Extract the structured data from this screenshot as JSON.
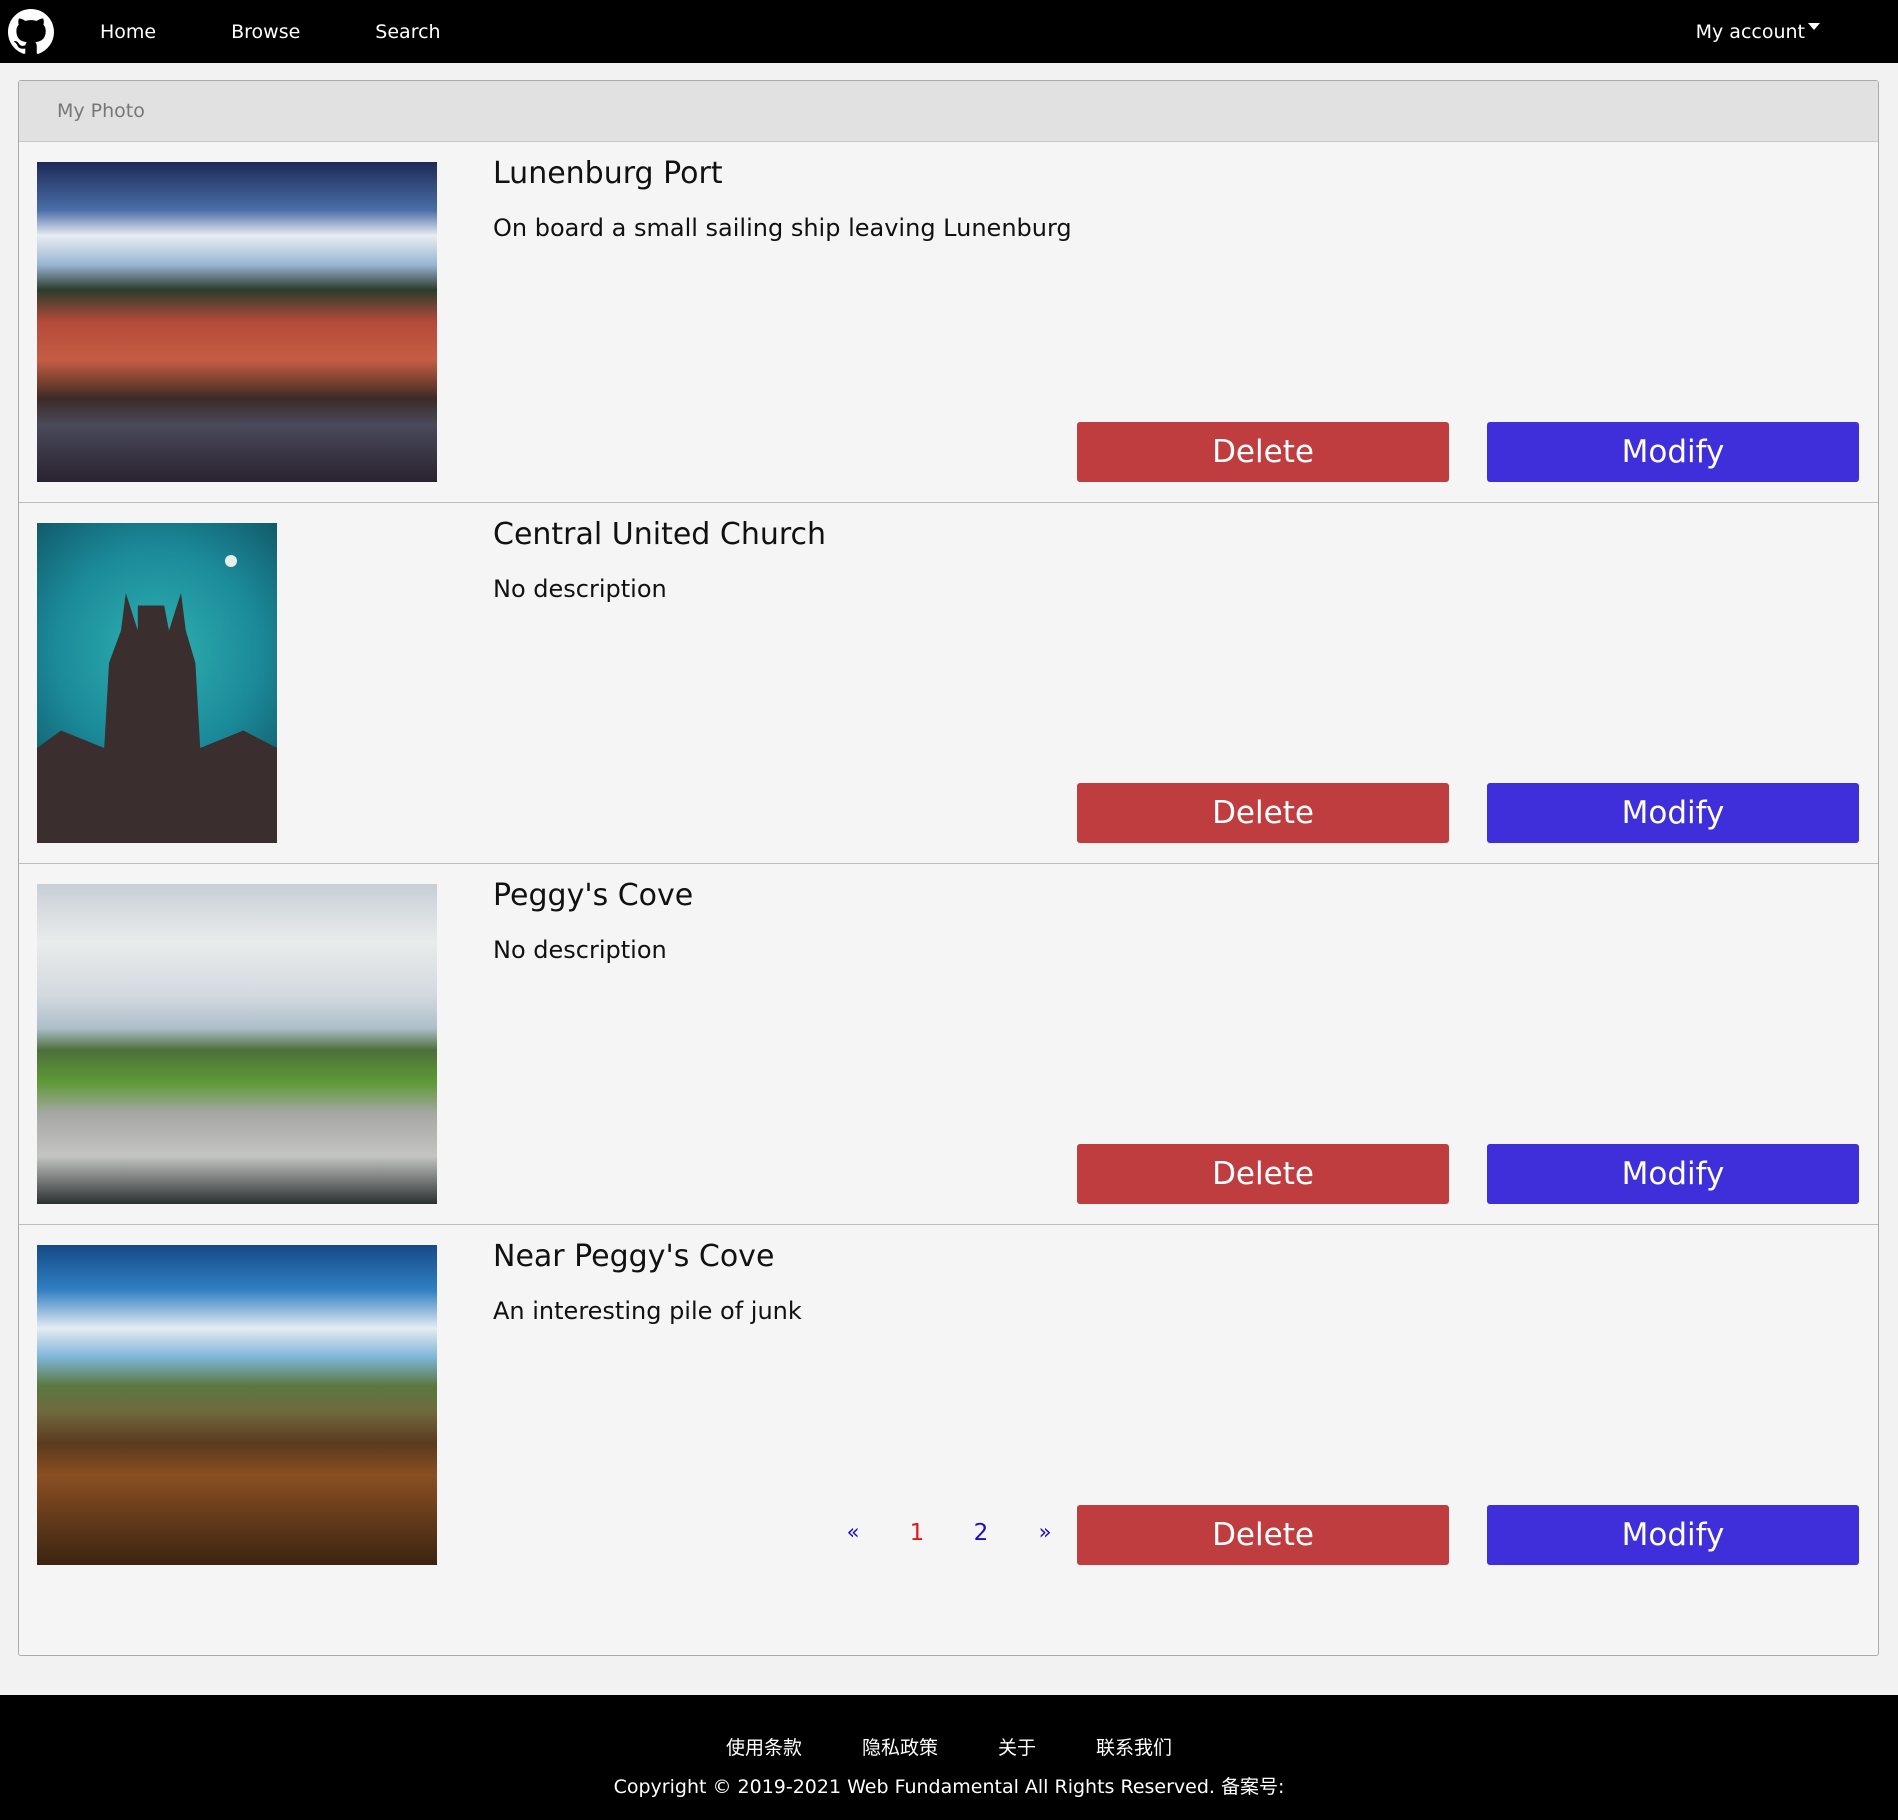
{
  "nav": {
    "logo_icon": "github-icon",
    "links": [
      "Home",
      "Browse",
      "Search"
    ],
    "account_label": "My account"
  },
  "panel": {
    "heading": "My Photo",
    "photos": [
      {
        "title": "Lunenburg Port",
        "description": "On board a small sailing ship leaving Lunenburg",
        "delete_label": "Delete",
        "modify_label": "Modify"
      },
      {
        "title": "Central United Church",
        "description": "No description",
        "delete_label": "Delete",
        "modify_label": "Modify"
      },
      {
        "title": "Peggy's Cove",
        "description": "No description",
        "delete_label": "Delete",
        "modify_label": "Modify"
      },
      {
        "title": "Near Peggy's Cove",
        "description": "An interesting pile of junk",
        "delete_label": "Delete",
        "modify_label": "Modify"
      }
    ]
  },
  "pagination": {
    "prev": "«",
    "pages": [
      "1",
      "2"
    ],
    "current": "1",
    "next": "»"
  },
  "footer": {
    "links": [
      "使用条款",
      "隐私政策",
      "关于",
      "联系我们"
    ],
    "copyright": "Copyright © 2019-2021 Web Fundamental All Rights Reserved. 备案号:"
  },
  "colors": {
    "delete": "#c03d3f",
    "modify": "#3f2fdb",
    "current_page": "#e01818",
    "page_link": "#1a0dbf"
  }
}
